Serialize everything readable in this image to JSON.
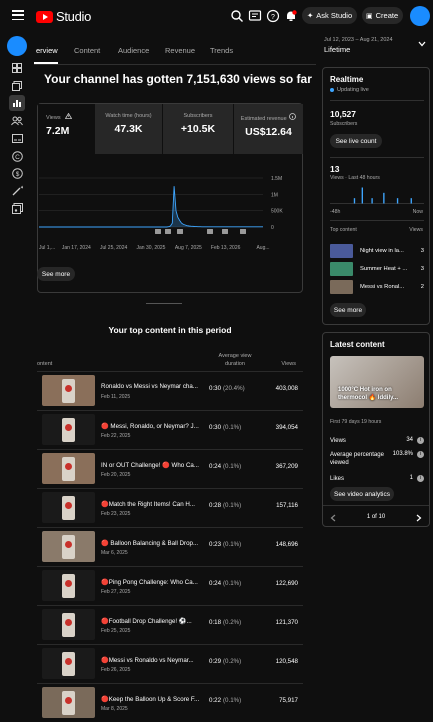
{
  "header": {
    "brand": "Studio",
    "ask_label": "Ask Studio",
    "create_label": "Create"
  },
  "tabs": [
    "erview",
    "Content",
    "Audience",
    "Revenue",
    "Trends"
  ],
  "date_range": {
    "range": "Jul 12, 2023 – Aug 21, 2024",
    "label": "Lifetime"
  },
  "headline": "Your channel has gotten 7,151,630 views so far",
  "stats": [
    {
      "label": "Views",
      "value": "7.2M"
    },
    {
      "label": "Watch time (hours)",
      "value": "47.3K"
    },
    {
      "label": "Subscribers",
      "value": "+10.5K"
    },
    {
      "label": "Estimated revenue",
      "value": "US$12.64"
    }
  ],
  "chart_data": {
    "type": "line",
    "x_ticks": [
      "Jul 1,...",
      "Jan 17, 2024",
      "Jul 25, 2024",
      "Jan 30, 2025",
      "Aug 7, 2025",
      "Feb 13, 2026",
      "Aug..."
    ],
    "y_ticks": [
      "1.5M",
      "1M",
      "500K",
      "0"
    ],
    "ylim": [
      0,
      1500000
    ],
    "series": [
      {
        "values": [
          0,
          0,
          0,
          0,
          0,
          0,
          0,
          0,
          0,
          0,
          0,
          0,
          0,
          0,
          0,
          0,
          0,
          0,
          0,
          0,
          0,
          0,
          0,
          0,
          0,
          0,
          0,
          0,
          0,
          0,
          0,
          0,
          0,
          0,
          0,
          0,
          0,
          0,
          0,
          0,
          0,
          0,
          0,
          0,
          0,
          0,
          0,
          0,
          0,
          0,
          0,
          0,
          0,
          0,
          0,
          0,
          0,
          0,
          0,
          0,
          0,
          0,
          0,
          0,
          0,
          0,
          0,
          0,
          0,
          0,
          10000,
          30000,
          120000,
          1250000,
          500000,
          300000,
          200000,
          120000,
          80000,
          60000,
          40000,
          30000,
          25000,
          20000,
          15000,
          12000,
          10000,
          8000,
          6000,
          5000,
          5000,
          5000,
          5000,
          5000,
          5000,
          5000,
          5000,
          5000,
          5000,
          5000,
          5000,
          5000,
          5000,
          5000,
          5000,
          5000,
          5000,
          5000,
          5000,
          5000,
          5000,
          5000,
          5000,
          5000,
          5000,
          5000,
          5000,
          5000,
          5000,
          5000,
          5000,
          5000
        ]
      }
    ]
  },
  "see_more_label": "See more",
  "top_content": {
    "title": "Your top content in this period",
    "col_content": "ontent",
    "col_avd": "Average view duration",
    "col_views": "Views",
    "rows": [
      {
        "title": "Ronaldo vs Messi vs Neymar cha...",
        "date": "Feb 11, 2025",
        "dur": "0:30",
        "pct": "(20.4%)",
        "views": "403,008",
        "thumb": "#8a6f5a"
      },
      {
        "title": "🔴 Messi, Ronaldo, or Neymar? J...",
        "date": "Feb 22, 2025",
        "dur": "0:30",
        "pct": "(0.1%)",
        "views": "394,054",
        "thumb": "#1a1a1a"
      },
      {
        "title": "IN or OUT Challenge! 🔴 Who Ca...",
        "date": "Feb 20, 2025",
        "dur": "0:24",
        "pct": "(0.1%)",
        "views": "367,209",
        "thumb": "#8a6f5a"
      },
      {
        "title": "🔴Match the Right Items! Can H...",
        "date": "Feb 23, 2025",
        "dur": "0:28",
        "pct": "(0.1%)",
        "views": "157,116",
        "thumb": "#1a1a1a"
      },
      {
        "title": "🔴 Balloon Balancing & Ball Drop...",
        "date": "Mar 6, 2025",
        "dur": "0:23",
        "pct": "(0.1%)",
        "views": "148,696",
        "thumb": "#8a7a6a"
      },
      {
        "title": "🔴Ping Pong Challenge: Who Ca...",
        "date": "Feb 27, 2025",
        "dur": "0:24",
        "pct": "(0.1%)",
        "views": "122,690",
        "thumb": "#1a1a1a"
      },
      {
        "title": "🔴Football Drop Challenge! ⚽...",
        "date": "Feb 25, 2025",
        "dur": "0:18",
        "pct": "(0.2%)",
        "views": "121,370",
        "thumb": "#1a1a1a"
      },
      {
        "title": "🔴Messi vs Ronaldo vs Neymar...",
        "date": "Feb 26, 2025",
        "dur": "0:29",
        "pct": "(0.2%)",
        "views": "120,548",
        "thumb": "#1a1a1a"
      },
      {
        "title": "🔴Keep the Balloon Up & Score F...",
        "date": "Mar 8, 2025",
        "dur": "0:22",
        "pct": "(0.1%)",
        "views": "75,917",
        "thumb": "#7a6a5a"
      }
    ]
  },
  "realtime": {
    "title": "Realtime",
    "status": "Updating live",
    "subs_value": "10,527",
    "subs_label": "Subscribers",
    "live_count_label": "See live count",
    "views_value": "13",
    "views_label": "Views · Last 48 hours",
    "axis_left": "-48h",
    "axis_right": "Now",
    "bars": [
      0,
      0,
      0,
      0,
      0,
      0,
      0,
      0,
      0,
      0,
      0,
      0,
      1,
      0,
      0,
      0,
      3,
      0,
      0,
      0,
      0,
      1,
      0,
      0,
      0,
      0,
      0,
      2,
      0,
      0,
      0,
      0,
      0,
      0,
      1,
      0,
      0,
      0,
      0,
      0,
      0,
      1,
      0,
      0,
      0,
      0,
      0,
      0
    ],
    "col_content": "Top content",
    "col_views": "Views",
    "items": [
      {
        "title": "Night view in la...",
        "views": "3",
        "thumb": "#4a5a9a"
      },
      {
        "title": "Summer Heat + ...",
        "views": "3",
        "thumb": "#3a8a6a"
      },
      {
        "title": "Messi vs Ronal...",
        "views": "2",
        "thumb": "#7a6a5a"
      }
    ],
    "see_more_label": "See more"
  },
  "latest": {
    "title": "Latest content",
    "thumb_text": "1000°C Hot iron on thermocol 🔥 Iddily...",
    "first_days": "First 79 days 19 hours",
    "metrics": [
      {
        "label": "Views",
        "value": "34"
      },
      {
        "label": "Average percentage viewed",
        "value": "103.8%"
      },
      {
        "label": "Likes",
        "value": "1"
      }
    ],
    "analytics_label": "See video analytics",
    "pager": "1 of 10"
  }
}
